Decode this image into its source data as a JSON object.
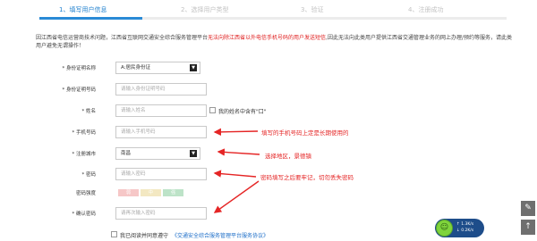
{
  "steps": [
    {
      "label": "1、填写用户信息",
      "active": true
    },
    {
      "label": "2、选择用户类型",
      "active": false
    },
    {
      "label": "3、验证",
      "active": false
    },
    {
      "label": "4、注册成功",
      "active": false
    }
  ],
  "notice": {
    "part1": "因江西省电信运营商技术问题，江西省互联网交通安全综合服务管理平台",
    "highlight": "无法向除江西省以外电信手机号码的用户发送短信",
    "part2": ",因此无法向此类用户提供江西省交通管理业务的网上办理/预约等服务，请此类用户避免无谓操作！"
  },
  "form": {
    "id_type": {
      "label": "* 身份证明名称",
      "value": "A:居民身份证"
    },
    "id_number": {
      "label": "* 身份证明号码",
      "placeholder": "请输入身份证明号码"
    },
    "name": {
      "label": "* 姓名",
      "placeholder": "请输入姓名",
      "checkbox_label": "我的姓名中含有\"口\""
    },
    "phone": {
      "label": "* 手机号码",
      "placeholder": "请输入手机号码"
    },
    "city": {
      "label": "* 注册城市",
      "value": "南昌"
    },
    "password": {
      "label": "* 密码",
      "placeholder": "请输入密码"
    },
    "strength": {
      "label": "密码强度",
      "levels": [
        "弱",
        "中",
        "强"
      ]
    },
    "confirm": {
      "label": "* 确认密码",
      "placeholder": "请再次输入密码"
    }
  },
  "annotations": {
    "phone": "填写的手机号码上定是长期使用的",
    "city": "选择地区，景德镇",
    "password": "密码填写之后要牢记，切勿丢失密码"
  },
  "agreement": {
    "text": "我已阅读并同意遵守",
    "link": "《交通安全综合服务管理平台服务协议》"
  },
  "side_buttons": [
    {
      "icon": "edit-icon",
      "glyph": "✎"
    },
    {
      "icon": "arrow-up-icon",
      "glyph": "↑"
    }
  ],
  "widget": {
    "upload": "↑ 1.3K/s",
    "download": "↓ 0.2K/s"
  },
  "colors": {
    "active_step": "#1d7fce",
    "annotation_red": "#e52525",
    "strength_weak": "#f6c7c7",
    "strength_medium": "#f3e8c2",
    "strength_strong": "#bde3c8"
  }
}
